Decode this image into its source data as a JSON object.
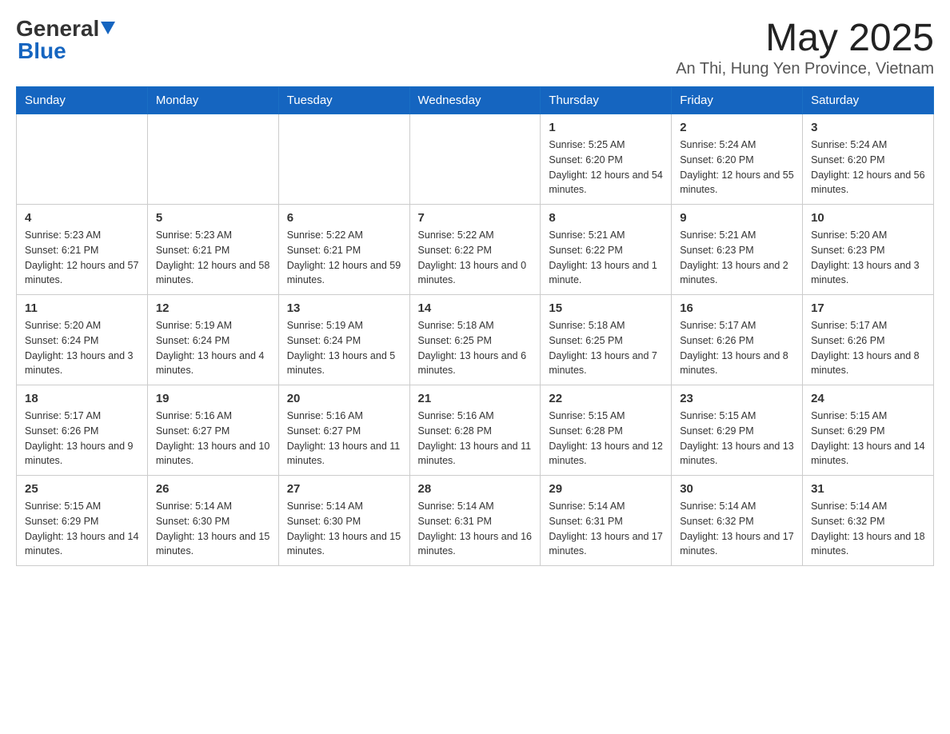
{
  "header": {
    "title": "May 2025",
    "subtitle": "An Thi, Hung Yen Province, Vietnam",
    "logo_general": "General",
    "logo_blue": "Blue"
  },
  "days_of_week": [
    "Sunday",
    "Monday",
    "Tuesday",
    "Wednesday",
    "Thursday",
    "Friday",
    "Saturday"
  ],
  "weeks": [
    {
      "days": [
        {
          "number": "",
          "info": ""
        },
        {
          "number": "",
          "info": ""
        },
        {
          "number": "",
          "info": ""
        },
        {
          "number": "",
          "info": ""
        },
        {
          "number": "1",
          "info": "Sunrise: 5:25 AM\nSunset: 6:20 PM\nDaylight: 12 hours and 54 minutes."
        },
        {
          "number": "2",
          "info": "Sunrise: 5:24 AM\nSunset: 6:20 PM\nDaylight: 12 hours and 55 minutes."
        },
        {
          "number": "3",
          "info": "Sunrise: 5:24 AM\nSunset: 6:20 PM\nDaylight: 12 hours and 56 minutes."
        }
      ]
    },
    {
      "days": [
        {
          "number": "4",
          "info": "Sunrise: 5:23 AM\nSunset: 6:21 PM\nDaylight: 12 hours and 57 minutes."
        },
        {
          "number": "5",
          "info": "Sunrise: 5:23 AM\nSunset: 6:21 PM\nDaylight: 12 hours and 58 minutes."
        },
        {
          "number": "6",
          "info": "Sunrise: 5:22 AM\nSunset: 6:21 PM\nDaylight: 12 hours and 59 minutes."
        },
        {
          "number": "7",
          "info": "Sunrise: 5:22 AM\nSunset: 6:22 PM\nDaylight: 13 hours and 0 minutes."
        },
        {
          "number": "8",
          "info": "Sunrise: 5:21 AM\nSunset: 6:22 PM\nDaylight: 13 hours and 1 minute."
        },
        {
          "number": "9",
          "info": "Sunrise: 5:21 AM\nSunset: 6:23 PM\nDaylight: 13 hours and 2 minutes."
        },
        {
          "number": "10",
          "info": "Sunrise: 5:20 AM\nSunset: 6:23 PM\nDaylight: 13 hours and 3 minutes."
        }
      ]
    },
    {
      "days": [
        {
          "number": "11",
          "info": "Sunrise: 5:20 AM\nSunset: 6:24 PM\nDaylight: 13 hours and 3 minutes."
        },
        {
          "number": "12",
          "info": "Sunrise: 5:19 AM\nSunset: 6:24 PM\nDaylight: 13 hours and 4 minutes."
        },
        {
          "number": "13",
          "info": "Sunrise: 5:19 AM\nSunset: 6:24 PM\nDaylight: 13 hours and 5 minutes."
        },
        {
          "number": "14",
          "info": "Sunrise: 5:18 AM\nSunset: 6:25 PM\nDaylight: 13 hours and 6 minutes."
        },
        {
          "number": "15",
          "info": "Sunrise: 5:18 AM\nSunset: 6:25 PM\nDaylight: 13 hours and 7 minutes."
        },
        {
          "number": "16",
          "info": "Sunrise: 5:17 AM\nSunset: 6:26 PM\nDaylight: 13 hours and 8 minutes."
        },
        {
          "number": "17",
          "info": "Sunrise: 5:17 AM\nSunset: 6:26 PM\nDaylight: 13 hours and 8 minutes."
        }
      ]
    },
    {
      "days": [
        {
          "number": "18",
          "info": "Sunrise: 5:17 AM\nSunset: 6:26 PM\nDaylight: 13 hours and 9 minutes."
        },
        {
          "number": "19",
          "info": "Sunrise: 5:16 AM\nSunset: 6:27 PM\nDaylight: 13 hours and 10 minutes."
        },
        {
          "number": "20",
          "info": "Sunrise: 5:16 AM\nSunset: 6:27 PM\nDaylight: 13 hours and 11 minutes."
        },
        {
          "number": "21",
          "info": "Sunrise: 5:16 AM\nSunset: 6:28 PM\nDaylight: 13 hours and 11 minutes."
        },
        {
          "number": "22",
          "info": "Sunrise: 5:15 AM\nSunset: 6:28 PM\nDaylight: 13 hours and 12 minutes."
        },
        {
          "number": "23",
          "info": "Sunrise: 5:15 AM\nSunset: 6:29 PM\nDaylight: 13 hours and 13 minutes."
        },
        {
          "number": "24",
          "info": "Sunrise: 5:15 AM\nSunset: 6:29 PM\nDaylight: 13 hours and 14 minutes."
        }
      ]
    },
    {
      "days": [
        {
          "number": "25",
          "info": "Sunrise: 5:15 AM\nSunset: 6:29 PM\nDaylight: 13 hours and 14 minutes."
        },
        {
          "number": "26",
          "info": "Sunrise: 5:14 AM\nSunset: 6:30 PM\nDaylight: 13 hours and 15 minutes."
        },
        {
          "number": "27",
          "info": "Sunrise: 5:14 AM\nSunset: 6:30 PM\nDaylight: 13 hours and 15 minutes."
        },
        {
          "number": "28",
          "info": "Sunrise: 5:14 AM\nSunset: 6:31 PM\nDaylight: 13 hours and 16 minutes."
        },
        {
          "number": "29",
          "info": "Sunrise: 5:14 AM\nSunset: 6:31 PM\nDaylight: 13 hours and 17 minutes."
        },
        {
          "number": "30",
          "info": "Sunrise: 5:14 AM\nSunset: 6:32 PM\nDaylight: 13 hours and 17 minutes."
        },
        {
          "number": "31",
          "info": "Sunrise: 5:14 AM\nSunset: 6:32 PM\nDaylight: 13 hours and 18 minutes."
        }
      ]
    }
  ]
}
